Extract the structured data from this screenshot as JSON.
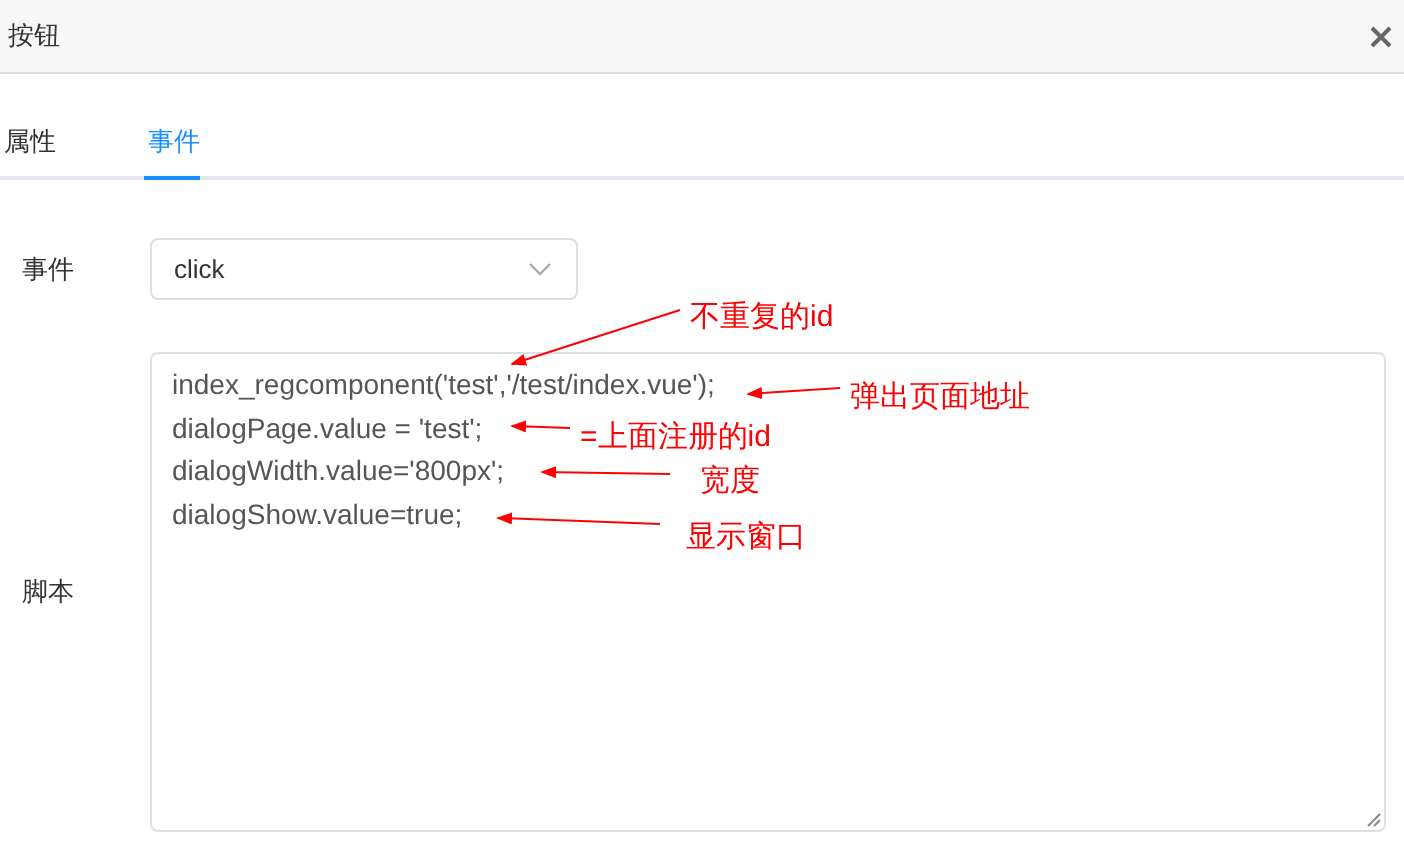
{
  "dialog": {
    "title": "按钮"
  },
  "tabs": [
    {
      "label": "属性",
      "selected": false
    },
    {
      "label": "事件",
      "selected": true
    }
  ],
  "form": {
    "event_label": "事件",
    "event_value": "click",
    "script_label": "脚本",
    "script_lines": [
      "index_regcomponent('test','/test/index.vue');",
      "dialogPage.value = 'test';",
      "dialogWidth.value='800px';",
      "dialogShow.value=true;"
    ]
  },
  "annotations": [
    {
      "text": "不重复的id"
    },
    {
      "text": "弹出页面地址"
    },
    {
      "text": "=上面注册的id"
    },
    {
      "text": "宽度"
    },
    {
      "text": "显示窗口"
    }
  ]
}
